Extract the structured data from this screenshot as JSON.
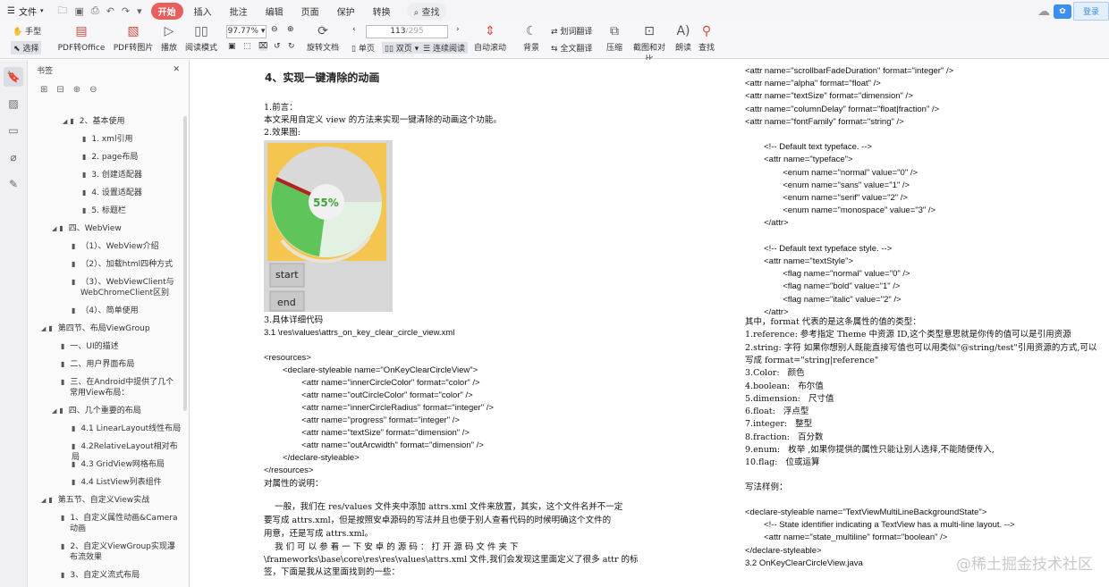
{
  "menubar": {
    "file_label": "文件",
    "items": [
      "开始",
      "插入",
      "批注",
      "编辑",
      "页面",
      "保护",
      "转换"
    ],
    "active": "开始",
    "search": "查找",
    "login": "登录"
  },
  "toolbar": {
    "hand": "手型",
    "select": "选择",
    "pdf_office": "PDF转Office",
    "pdf_image": "PDF转图片",
    "play": "播放",
    "read_mode": "阅读模式",
    "zoom": "97.77%",
    "rotate": "旋转文档",
    "page_current": "113",
    "page_total": "/295",
    "single": "单页",
    "double": "双页",
    "continuous": "连续阅读",
    "auto_scroll": "自动滚动",
    "background": "背景",
    "translate_word": "划词翻译",
    "translate_all": "全文翻译",
    "compress": "压缩",
    "screenshot": "截图和对比",
    "read_aloud": "朗读",
    "find": "查找"
  },
  "panel": {
    "title": "书签",
    "items": [
      {
        "label": "2、基本使用",
        "level": 2,
        "tri": true
      },
      {
        "label": "1. xml引用",
        "level": 3
      },
      {
        "label": "2. page布局",
        "level": 3
      },
      {
        "label": "3. 创建适配器",
        "level": 3
      },
      {
        "label": "4. 设置适配器",
        "level": 3
      },
      {
        "label": "5. 标题栏",
        "level": 3
      },
      {
        "label": "四、WebView",
        "level": 1,
        "tri": true
      },
      {
        "label": "（1）、WebView介绍",
        "level": 2
      },
      {
        "label": "（2）、加载html四种方式",
        "level": 2
      },
      {
        "label": "（3）、WebViewClient与",
        "label2": "WebChromeClient区别",
        "level": 2
      },
      {
        "label": "（4）、简单使用",
        "level": 2
      },
      {
        "label": "第四节、布局ViewGroup",
        "level": 0,
        "tri": true
      },
      {
        "label": "一、UI的描述",
        "level": 1
      },
      {
        "label": "二、用户界面布局",
        "level": 1
      },
      {
        "label": "三、在Android中提供了几个",
        "label2": "常用View布局：",
        "level": 1
      },
      {
        "label": "四、几个重要的布局",
        "level": 1,
        "tri": true
      },
      {
        "label": "4.1 LinearLayout线性布局",
        "level": 2
      },
      {
        "label": "4.2RelativeLayout相对布局",
        "level": 2
      },
      {
        "label": "4.3 GridView网格布局",
        "level": 2
      },
      {
        "label": "4.4 ListView列表组件",
        "level": 2
      },
      {
        "label": "第五节、自定义View实战",
        "level": 0,
        "tri": true
      },
      {
        "label": "1、自定义属性动画&Camera",
        "label2": "动画",
        "level": 1
      },
      {
        "label": "2、自定义ViewGroup实现瀑",
        "label2": "布流效果",
        "level": 1
      },
      {
        "label": "3、自定义流式布局",
        "level": 1
      }
    ]
  },
  "doc_left": {
    "heading": "4、实现一键清除的动画",
    "preface": "1.前言：",
    "intro": "本文采用自定义 view 的方法来实现一键清除的动画这个功能。",
    "effect": "2.效果图:",
    "percent": "55%",
    "start_btn": "start",
    "end_btn": "end",
    "code_title": "3.具体详细代码",
    "file_path": "3.1 \\res\\values\\attrs_on_key_clear_circle_view.xml",
    "code_lines": [
      "<resources>",
      "        <declare-styleable name=\"OnKeyClearCircleView\">",
      "                <attr name=\"innerCircleColor\" format=\"color\" />",
      "                <attr name=\"outCircleColor\" format=\"color\" />",
      "                <attr name=\"innerCircleRadius\" format=\"integer\" />",
      "                <attr name=\"progress\" format=\"integer\" />",
      "                <attr name=\"textSize\" format=\"dimension\" />",
      "                <attr name=\"outArcwidth\" format=\"dimension\" />",
      "        </declare-styleable>",
      "</resources>"
    ],
    "attr_desc": "对属性的说明：",
    "para1": "    一般，我们在 res/values 文件夹中添加 attrs.xml 文件来放置，其实，这个文件名并不一定",
    "para2": "要写成 attrs.xml，但是按照安卓源码的写法并且也便于别人查看代码的时候明确这个文件的",
    "para3": "用意，还是写成 attrs.xml。",
    "para4": "    我 们 可 以 参 看 一 下 安 卓 的 源 码 ： 打 开 源 码 文 件 夹 下",
    "para5": "\\frameworks\\base\\core\\res\\res\\values\\attrs.xml 文件,我们会发现这里面定义了很多 attr 的标",
    "para6": "签，下面是我从这里面找到的一些："
  },
  "doc_right": {
    "code_lines": [
      "<attr name=\"scrollbarFadeDuration\" format=\"integer\" />",
      "<attr name=\"alpha\" format=\"float\" />",
      "<attr name=\"textSize\" format=\"dimension\" />",
      "<attr name=\"columnDelay\" format=\"float|fraction\" />",
      "<attr name=\"fontFamily\" format=\"string\" />",
      "",
      "        <!-- Default text typeface. -->",
      "        <attr name=\"typeface\">",
      "                <enum name=\"normal\" value=\"0\" />",
      "                <enum name=\"sans\" value=\"1\" />",
      "                <enum name=\"serif\" value=\"2\" />",
      "                <enum name=\"monospace\" value=\"3\" />",
      "        </attr>",
      "",
      "        <!-- Default text typeface style. -->",
      "        <attr name=\"textStyle\">",
      "                <flag name=\"normal\" value=\"0\" />",
      "                <flag name=\"bold\" value=\"1\" />",
      "                <flag name=\"italic\" value=\"2\" />",
      "        </attr>"
    ],
    "desc_lines": [
      "其中，format 代表的是这条属性的值的类型：",
      "1.reference: 参考指定 Theme 中资源 ID,这个类型意思就是你传的值可以是引用资源",
      "2.string: 字符 如果你想别人既能直接写值也可以用类似\"@string/test\"引用资源的方式,可以",
      "写成 format=\"string|reference\"",
      "3.Color:   颜色",
      "4.boolean:   布尔值",
      "5.dimension:   尺寸值",
      "6.float:   浮点型",
      "7.integer:   整型",
      "8.fraction:   百分数",
      "9.enum:   枚举 ,如果你提供的属性只能让别人选择,不能随便传入,",
      "10.flag:   位或运算"
    ],
    "example_title": "写法样例：",
    "example_lines": [
      "<declare-styleable name=\"TextViewMultiLineBackgroundState\">",
      "        <!-- State identifier indicating a TextView has a multi-line layout. -->",
      "        <attr name=\"state_multiline\" format=\"boolean\" />",
      "</declare-styleable>",
      "3.2 OnKeyClearCircleView.java"
    ]
  },
  "watermark": "@稀土掘金技术社区",
  "colors": {
    "accent": "#e85d5d",
    "gauge_bg": "#f4c54f",
    "gauge_green": "#5fc45a"
  }
}
